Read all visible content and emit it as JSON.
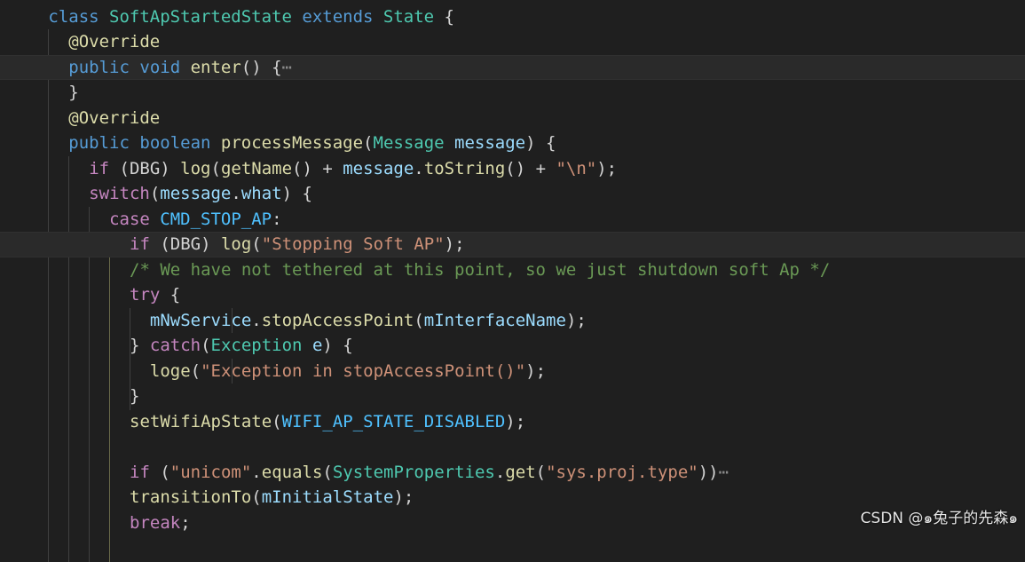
{
  "editor": {
    "lines": [
      {
        "indent": 2,
        "tokens": [
          [
            "kw",
            "class "
          ],
          [
            "cls",
            "SoftApStartedState"
          ],
          [
            "kw",
            " extends "
          ],
          [
            "cls",
            "State"
          ],
          [
            "punc",
            " {"
          ]
        ]
      },
      {
        "indent": 4,
        "tokens": [
          [
            "ann",
            "@Override"
          ]
        ]
      },
      {
        "indent": 4,
        "highlight": true,
        "tokens": [
          [
            "kw",
            "public "
          ],
          [
            "kw",
            "void "
          ],
          [
            "fn",
            "enter"
          ],
          [
            "punc",
            "() {"
          ],
          [
            "ellipsis",
            "⋯"
          ]
        ]
      },
      {
        "indent": 4,
        "tokens": [
          [
            "punc",
            "}"
          ]
        ]
      },
      {
        "indent": 4,
        "tokens": [
          [
            "ann",
            "@Override"
          ]
        ]
      },
      {
        "indent": 4,
        "tokens": [
          [
            "kw",
            "public "
          ],
          [
            "kw",
            "boolean "
          ],
          [
            "fn",
            "processMessage"
          ],
          [
            "punc",
            "("
          ],
          [
            "cls",
            "Message "
          ],
          [
            "var",
            "message"
          ],
          [
            "punc",
            ") {"
          ]
        ]
      },
      {
        "indent": 6,
        "tokens": [
          [
            "ctl",
            "if "
          ],
          [
            "punc",
            "(DBG) "
          ],
          [
            "fn",
            "log"
          ],
          [
            "punc",
            "("
          ],
          [
            "fn",
            "getName"
          ],
          [
            "punc",
            "() + "
          ],
          [
            "var",
            "message"
          ],
          [
            "punc",
            "."
          ],
          [
            "fn",
            "toString"
          ],
          [
            "punc",
            "() + "
          ],
          [
            "str",
            "\"\\n\""
          ],
          [
            "punc",
            ");"
          ]
        ]
      },
      {
        "indent": 6,
        "tokens": [
          [
            "ctl",
            "switch"
          ],
          [
            "punc",
            "("
          ],
          [
            "var",
            "message"
          ],
          [
            "punc",
            "."
          ],
          [
            "var",
            "what"
          ],
          [
            "punc",
            ") {"
          ]
        ]
      },
      {
        "indent": 8,
        "tokens": [
          [
            "ctl",
            "case "
          ],
          [
            "const",
            "CMD_STOP_AP"
          ],
          [
            "punc",
            ":"
          ]
        ]
      },
      {
        "indent": 10,
        "highlight": true,
        "tokens": [
          [
            "ctl",
            "if "
          ],
          [
            "punc",
            "(DBG) "
          ],
          [
            "fn",
            "log"
          ],
          [
            "punc",
            "("
          ],
          [
            "str",
            "\"Stopping Soft AP\""
          ],
          [
            "punc",
            ");"
          ]
        ]
      },
      {
        "indent": 10,
        "tokens": [
          [
            "cmt",
            "/* We have not tethered at this point, so we just shutdown soft Ap */"
          ]
        ]
      },
      {
        "indent": 10,
        "tokens": [
          [
            "ctl",
            "try "
          ],
          [
            "punc",
            "{"
          ]
        ]
      },
      {
        "indent": 12,
        "tokens": [
          [
            "var",
            "mNwService"
          ],
          [
            "punc",
            "."
          ],
          [
            "fn",
            "stopAccessPoint"
          ],
          [
            "punc",
            "("
          ],
          [
            "var",
            "mInterfaceName"
          ],
          [
            "punc",
            ");"
          ]
        ]
      },
      {
        "indent": 10,
        "tokens": [
          [
            "punc",
            "} "
          ],
          [
            "ctl",
            "catch"
          ],
          [
            "punc",
            "("
          ],
          [
            "cls",
            "Exception "
          ],
          [
            "var",
            "e"
          ],
          [
            "punc",
            ") {"
          ]
        ]
      },
      {
        "indent": 12,
        "tokens": [
          [
            "fn",
            "loge"
          ],
          [
            "punc",
            "("
          ],
          [
            "str",
            "\"Exception in stopAccessPoint()\""
          ],
          [
            "punc",
            ");"
          ]
        ]
      },
      {
        "indent": 10,
        "tokens": [
          [
            "punc",
            "}"
          ]
        ]
      },
      {
        "indent": 10,
        "tokens": [
          [
            "fn",
            "setWifiApState"
          ],
          [
            "punc",
            "("
          ],
          [
            "const",
            "WIFI_AP_STATE_DISABLED"
          ],
          [
            "punc",
            ");"
          ]
        ]
      },
      {
        "indent": 10,
        "tokens": []
      },
      {
        "indent": 10,
        "tokens": [
          [
            "ctl",
            "if "
          ],
          [
            "punc",
            "("
          ],
          [
            "str",
            "\"unicom\""
          ],
          [
            "punc",
            "."
          ],
          [
            "fn",
            "equals"
          ],
          [
            "punc",
            "("
          ],
          [
            "cls",
            "SystemProperties"
          ],
          [
            "punc",
            "."
          ],
          [
            "fn",
            "get"
          ],
          [
            "punc",
            "("
          ],
          [
            "str",
            "\"sys.proj.type\""
          ],
          [
            "punc",
            "))"
          ],
          [
            "ellipsis",
            "⋯"
          ]
        ]
      },
      {
        "indent": 10,
        "tokens": [
          [
            "fn",
            "transitionTo"
          ],
          [
            "punc",
            "("
          ],
          [
            "var",
            "mInitialState"
          ],
          [
            "punc",
            ");"
          ]
        ]
      },
      {
        "indent": 10,
        "tokens": [
          [
            "ctl",
            "break"
          ],
          [
            "punc",
            ";"
          ]
        ]
      }
    ]
  },
  "colors": {
    "background": "#1f1f1f",
    "keyword": "#569cd6",
    "control": "#c586c0",
    "class": "#4ec9b0",
    "function": "#dcdcaa",
    "variable": "#9cdcfe",
    "string": "#ce9178",
    "comment": "#6a9955",
    "constant": "#4fc1ff"
  },
  "watermark": "CSDN @๑兔子的先森๑"
}
